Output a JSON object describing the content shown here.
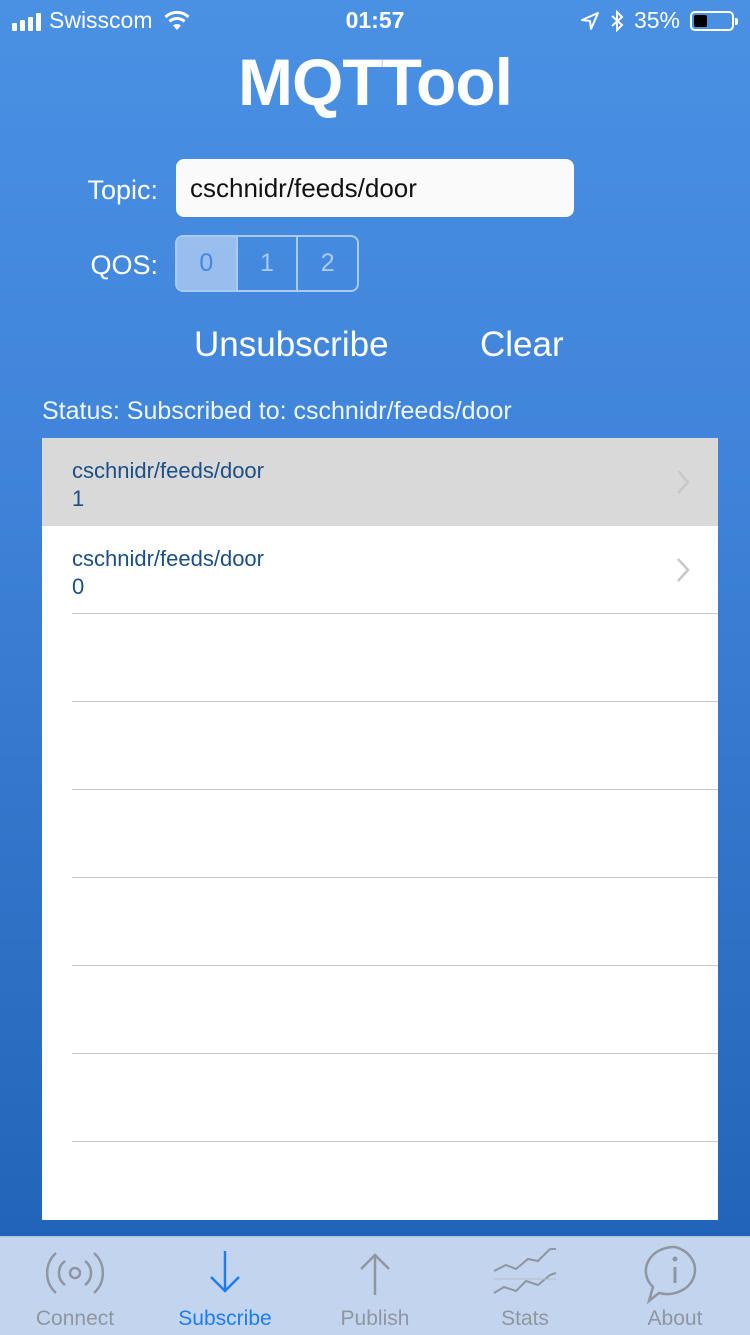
{
  "status_bar": {
    "carrier": "Swisscom",
    "time": "01:57",
    "battery": "35%",
    "battery_level": 0.35
  },
  "app": {
    "title": "MQTTool"
  },
  "form": {
    "topic_label": "Topic:",
    "topic_value": "cschnidr/feeds/door",
    "qos_label": "QOS:",
    "qos_options": [
      "0",
      "1",
      "2"
    ],
    "qos_selected": "0"
  },
  "actions": {
    "unsubscribe": "Unsubscribe",
    "clear": "Clear"
  },
  "status_text": "Status: Subscribed to: cschnidr/feeds/door",
  "messages": [
    {
      "topic": "cschnidr/feeds/door",
      "payload": "1",
      "selected": true
    },
    {
      "topic": "cschnidr/feeds/door",
      "payload": "0",
      "selected": false
    }
  ],
  "tabs": [
    {
      "label": "Connect",
      "icon": "broadcast-icon",
      "active": false
    },
    {
      "label": "Subscribe",
      "icon": "arrow-down-icon",
      "active": true
    },
    {
      "label": "Publish",
      "icon": "arrow-up-icon",
      "active": false
    },
    {
      "label": "Stats",
      "icon": "stats-icon",
      "active": false
    },
    {
      "label": "About",
      "icon": "info-icon",
      "active": false
    }
  ],
  "colors": {
    "accent": "#1d7cf2",
    "background_top": "#4a90e3",
    "cell_text": "#1c4f86"
  }
}
